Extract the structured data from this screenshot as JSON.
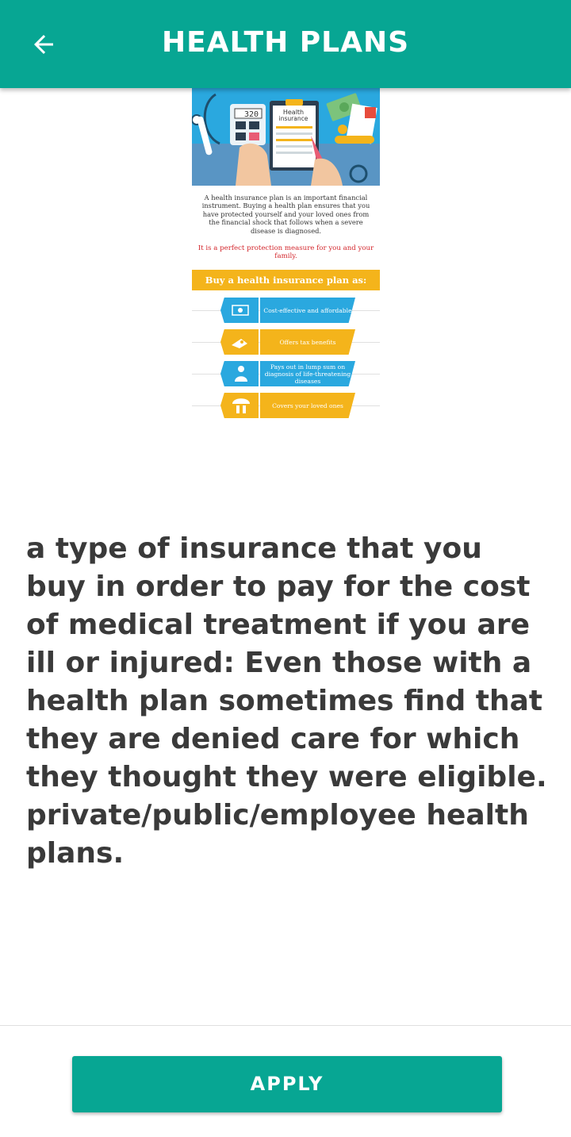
{
  "appbar": {
    "title": "HEALTH PLANS",
    "back_icon": "arrow-left-icon"
  },
  "infographic": {
    "header_illustration": {
      "calculator_display": "320",
      "clipboard_title": "Health insurance"
    },
    "intro": "A health insurance plan is an important financial instrument. Buying a health plan ensures that you have protected yourself and your loved ones from the financial shock that follows when a severe disease is diagnosed.",
    "highlight": "It is a perfect protection measure for you and your family.",
    "bar_title": "Buy a health insurance plan as:",
    "items": [
      {
        "label": "Cost-effective and affordable",
        "icon": "money-icon",
        "color": "#2aa8df"
      },
      {
        "label": "Offers tax benefits",
        "icon": "money-hand-icon",
        "color": "#f4b41b"
      },
      {
        "label": "Pays out in lump sum on diagnosis of life-threatening diseases",
        "icon": "doctor-icon",
        "color": "#2aa8df"
      },
      {
        "label": "Covers your loved ones",
        "icon": "family-umbrella-icon",
        "color": "#f4b41b"
      }
    ]
  },
  "description": "a type of insurance that you buy in order to pay for the cost of medical treatment if you are ill or injured: Even those with a health plan sometimes find that they are denied care for which they thought they were eligible. private/public/employee health plans.",
  "footer": {
    "apply_label": "APPLY"
  },
  "colors": {
    "primary": "#07a693",
    "text": "#3a3a3a",
    "infographic_blue": "#2aa8df",
    "infographic_yellow": "#f4b41b",
    "infographic_red": "#d3262c"
  }
}
